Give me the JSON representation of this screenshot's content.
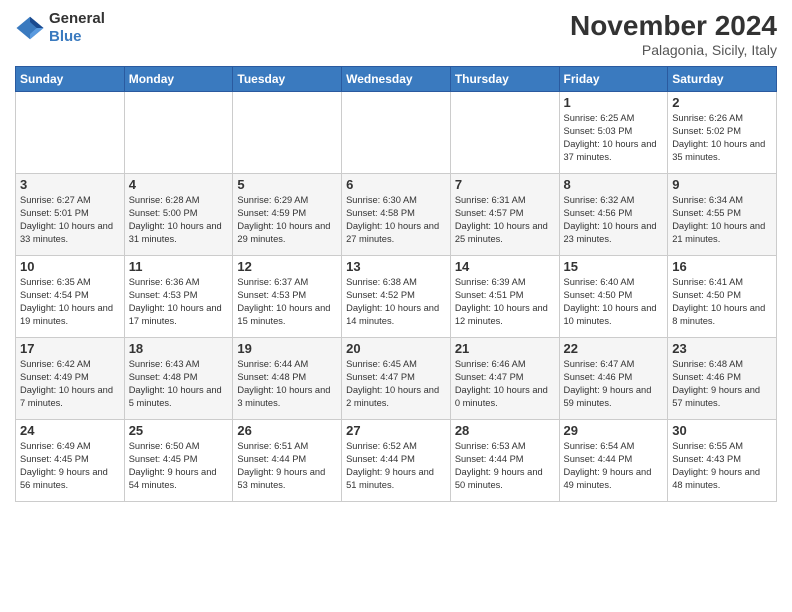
{
  "header": {
    "logo_general": "General",
    "logo_blue": "Blue",
    "month_title": "November 2024",
    "location": "Palagonia, Sicily, Italy"
  },
  "days_of_week": [
    "Sunday",
    "Monday",
    "Tuesday",
    "Wednesday",
    "Thursday",
    "Friday",
    "Saturday"
  ],
  "weeks": [
    [
      {
        "day": "",
        "info": ""
      },
      {
        "day": "",
        "info": ""
      },
      {
        "day": "",
        "info": ""
      },
      {
        "day": "",
        "info": ""
      },
      {
        "day": "",
        "info": ""
      },
      {
        "day": "1",
        "info": "Sunrise: 6:25 AM\nSunset: 5:03 PM\nDaylight: 10 hours and 37 minutes."
      },
      {
        "day": "2",
        "info": "Sunrise: 6:26 AM\nSunset: 5:02 PM\nDaylight: 10 hours and 35 minutes."
      }
    ],
    [
      {
        "day": "3",
        "info": "Sunrise: 6:27 AM\nSunset: 5:01 PM\nDaylight: 10 hours and 33 minutes."
      },
      {
        "day": "4",
        "info": "Sunrise: 6:28 AM\nSunset: 5:00 PM\nDaylight: 10 hours and 31 minutes."
      },
      {
        "day": "5",
        "info": "Sunrise: 6:29 AM\nSunset: 4:59 PM\nDaylight: 10 hours and 29 minutes."
      },
      {
        "day": "6",
        "info": "Sunrise: 6:30 AM\nSunset: 4:58 PM\nDaylight: 10 hours and 27 minutes."
      },
      {
        "day": "7",
        "info": "Sunrise: 6:31 AM\nSunset: 4:57 PM\nDaylight: 10 hours and 25 minutes."
      },
      {
        "day": "8",
        "info": "Sunrise: 6:32 AM\nSunset: 4:56 PM\nDaylight: 10 hours and 23 minutes."
      },
      {
        "day": "9",
        "info": "Sunrise: 6:34 AM\nSunset: 4:55 PM\nDaylight: 10 hours and 21 minutes."
      }
    ],
    [
      {
        "day": "10",
        "info": "Sunrise: 6:35 AM\nSunset: 4:54 PM\nDaylight: 10 hours and 19 minutes."
      },
      {
        "day": "11",
        "info": "Sunrise: 6:36 AM\nSunset: 4:53 PM\nDaylight: 10 hours and 17 minutes."
      },
      {
        "day": "12",
        "info": "Sunrise: 6:37 AM\nSunset: 4:53 PM\nDaylight: 10 hours and 15 minutes."
      },
      {
        "day": "13",
        "info": "Sunrise: 6:38 AM\nSunset: 4:52 PM\nDaylight: 10 hours and 14 minutes."
      },
      {
        "day": "14",
        "info": "Sunrise: 6:39 AM\nSunset: 4:51 PM\nDaylight: 10 hours and 12 minutes."
      },
      {
        "day": "15",
        "info": "Sunrise: 6:40 AM\nSunset: 4:50 PM\nDaylight: 10 hours and 10 minutes."
      },
      {
        "day": "16",
        "info": "Sunrise: 6:41 AM\nSunset: 4:50 PM\nDaylight: 10 hours and 8 minutes."
      }
    ],
    [
      {
        "day": "17",
        "info": "Sunrise: 6:42 AM\nSunset: 4:49 PM\nDaylight: 10 hours and 7 minutes."
      },
      {
        "day": "18",
        "info": "Sunrise: 6:43 AM\nSunset: 4:48 PM\nDaylight: 10 hours and 5 minutes."
      },
      {
        "day": "19",
        "info": "Sunrise: 6:44 AM\nSunset: 4:48 PM\nDaylight: 10 hours and 3 minutes."
      },
      {
        "day": "20",
        "info": "Sunrise: 6:45 AM\nSunset: 4:47 PM\nDaylight: 10 hours and 2 minutes."
      },
      {
        "day": "21",
        "info": "Sunrise: 6:46 AM\nSunset: 4:47 PM\nDaylight: 10 hours and 0 minutes."
      },
      {
        "day": "22",
        "info": "Sunrise: 6:47 AM\nSunset: 4:46 PM\nDaylight: 9 hours and 59 minutes."
      },
      {
        "day": "23",
        "info": "Sunrise: 6:48 AM\nSunset: 4:46 PM\nDaylight: 9 hours and 57 minutes."
      }
    ],
    [
      {
        "day": "24",
        "info": "Sunrise: 6:49 AM\nSunset: 4:45 PM\nDaylight: 9 hours and 56 minutes."
      },
      {
        "day": "25",
        "info": "Sunrise: 6:50 AM\nSunset: 4:45 PM\nDaylight: 9 hours and 54 minutes."
      },
      {
        "day": "26",
        "info": "Sunrise: 6:51 AM\nSunset: 4:44 PM\nDaylight: 9 hours and 53 minutes."
      },
      {
        "day": "27",
        "info": "Sunrise: 6:52 AM\nSunset: 4:44 PM\nDaylight: 9 hours and 51 minutes."
      },
      {
        "day": "28",
        "info": "Sunrise: 6:53 AM\nSunset: 4:44 PM\nDaylight: 9 hours and 50 minutes."
      },
      {
        "day": "29",
        "info": "Sunrise: 6:54 AM\nSunset: 4:44 PM\nDaylight: 9 hours and 49 minutes."
      },
      {
        "day": "30",
        "info": "Sunrise: 6:55 AM\nSunset: 4:43 PM\nDaylight: 9 hours and 48 minutes."
      }
    ]
  ]
}
